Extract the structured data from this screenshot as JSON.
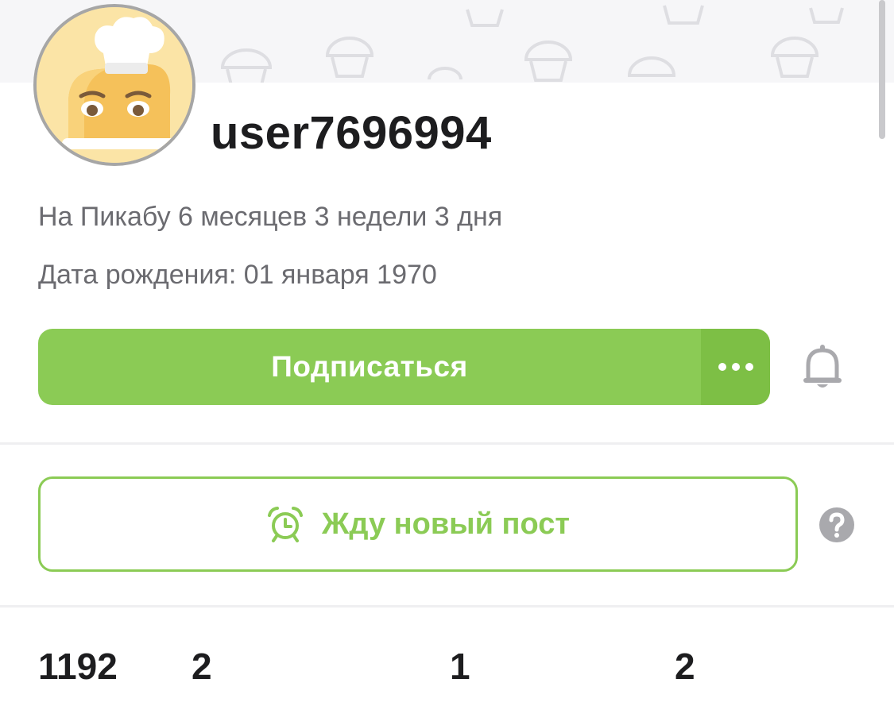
{
  "profile": {
    "username": "user7696994",
    "tenure": "На Пикабу 6 месяцев 3 недели 3 дня",
    "birthday": "Дата рождения: 01 января 1970",
    "avatar_icon": "chef-toast-avatar-icon"
  },
  "actions": {
    "subscribe_label": "Подписаться",
    "more_icon": "more-dots-icon",
    "bell_icon": "bell-icon",
    "wait_post_label": "Жду новый пост",
    "alarm_icon": "alarm-clock-icon",
    "help_icon": "question-icon"
  },
  "stats": [
    "1192",
    "2",
    "1",
    "2"
  ],
  "colors": {
    "accent_green": "#8bcb55",
    "accent_green_dark": "#7dbf45",
    "text_primary": "#1d1d1f",
    "text_secondary": "#6b6b70"
  }
}
